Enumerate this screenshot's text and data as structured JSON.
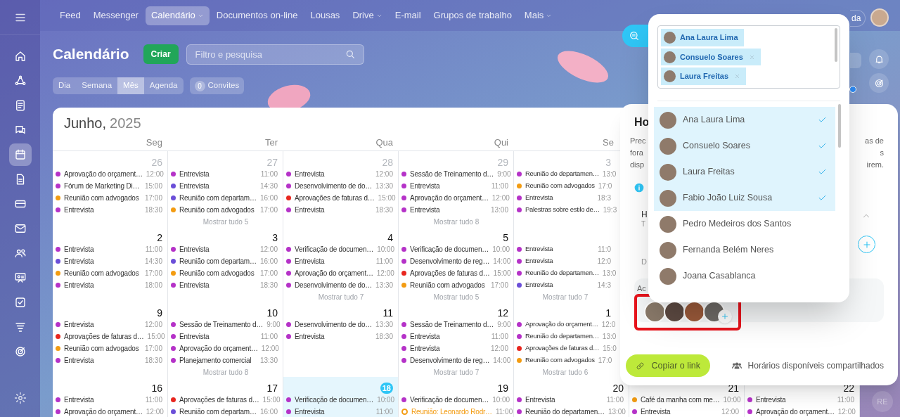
{
  "sidebar": {
    "items": [
      {
        "kind": "home",
        "selected": false
      },
      {
        "kind": "network",
        "selected": false
      },
      {
        "kind": "document",
        "selected": false
      },
      {
        "kind": "chat",
        "selected": false
      },
      {
        "kind": "calendar",
        "selected": true
      },
      {
        "kind": "file",
        "selected": false
      },
      {
        "kind": "card",
        "selected": false
      },
      {
        "kind": "mail",
        "selected": false
      },
      {
        "kind": "contacts",
        "selected": false
      },
      {
        "kind": "board",
        "selected": false
      },
      {
        "kind": "tasks",
        "selected": false
      },
      {
        "kind": "filter",
        "selected": false
      },
      {
        "kind": "target",
        "selected": false
      }
    ]
  },
  "nav": {
    "items": [
      {
        "label": "Feed",
        "selected": false,
        "dropdown": false
      },
      {
        "label": "Messenger",
        "selected": false,
        "dropdown": false
      },
      {
        "label": "Calendário",
        "selected": true,
        "dropdown": true
      },
      {
        "label": "Documentos on-line",
        "selected": false,
        "dropdown": false
      },
      {
        "label": "Lousas",
        "selected": false,
        "dropdown": false
      },
      {
        "label": "Drive",
        "selected": false,
        "dropdown": true
      },
      {
        "label": "E-mail",
        "selected": false,
        "dropdown": false
      },
      {
        "label": "Grupos de trabalho",
        "selected": false,
        "dropdown": false
      },
      {
        "label": "Mais",
        "selected": false,
        "dropdown": true
      }
    ],
    "help_fragment": "da"
  },
  "header": {
    "title": "Calendário",
    "create_button": "Criar",
    "search": {
      "placeholder": "Filtro e pesquisa"
    }
  },
  "views": [
    {
      "label": "Dia",
      "selected": false
    },
    {
      "label": "Semana",
      "selected": false
    },
    {
      "label": "Mês",
      "selected": true
    },
    {
      "label": "Agenda",
      "selected": false
    }
  ],
  "invites": {
    "count": "0",
    "label": "Convites"
  },
  "calendar": {
    "month": "Junho,",
    "year": "2025",
    "weekdays": [
      "Seg",
      "Ter",
      "Qua",
      "Qui",
      "Se"
    ],
    "weeks": [
      {
        "days": [
          {
            "date": "26",
            "muted": true,
            "today": false,
            "events": [
              {
                "title": "Aprovação do orçament…",
                "time": "12:00",
                "color": "#b532c8",
                "kind": "event"
              },
              {
                "title": "Fórum de Marketing Di…",
                "time": "15:00",
                "color": "#b532c8",
                "kind": "event"
              },
              {
                "title": "Reunião com advogados",
                "time": "17:00",
                "color": "#f39c12",
                "kind": "event"
              },
              {
                "title": "Entrevista",
                "time": "18:30",
                "color": "#b532c8",
                "kind": "event"
              }
            ]
          },
          {
            "date": "27",
            "muted": true,
            "today": false,
            "more": "Mostrar tudo 5",
            "events": [
              {
                "title": "Entrevista",
                "time": "11:00",
                "color": "#b532c8",
                "kind": "event"
              },
              {
                "title": "Entrevista",
                "time": "14:30",
                "color": "#6b4fd8",
                "kind": "event"
              },
              {
                "title": "Reunião com departam…",
                "time": "16:00",
                "color": "#6b4fd8",
                "kind": "event"
              },
              {
                "title": "Reunião com advogados",
                "time": "17:00",
                "color": "#f39c12",
                "kind": "event"
              }
            ]
          },
          {
            "date": "28",
            "muted": true,
            "today": false,
            "events": [
              {
                "title": "Entrevista",
                "time": "12:00",
                "color": "#b532c8",
                "kind": "event"
              },
              {
                "title": "Desenvolvimento de do…",
                "time": "13:30",
                "color": "#b532c8",
                "kind": "event"
              },
              {
                "title": "Aprovações de faturas d…",
                "time": "15:00",
                "color": "#e8261f",
                "kind": "event"
              },
              {
                "title": "Entrevista",
                "time": "18:30",
                "color": "#b532c8",
                "kind": "event"
              }
            ]
          },
          {
            "date": "29",
            "muted": true,
            "today": false,
            "more": "Mostrar tudo 8",
            "events": [
              {
                "title": "Sessão de Treinamento d…",
                "time": "9:00",
                "color": "#b532c8",
                "kind": "event"
              },
              {
                "title": "Entrevista",
                "time": "11:00",
                "color": "#b532c8",
                "kind": "event"
              },
              {
                "title": "Aprovação do orçament…",
                "time": "12:00",
                "color": "#b532c8",
                "kind": "event"
              },
              {
                "title": "Entrevista",
                "time": "13:00",
                "color": "#b532c8",
                "kind": "event"
              }
            ]
          },
          {
            "date": "3",
            "muted": true,
            "today": false,
            "events": [
              {
                "title": "Reunião do departamen…",
                "time": "13:0",
                "color": "#b532c8",
                "kind": "event"
              },
              {
                "title": "Reunião com advogados",
                "time": "17:0",
                "color": "#f39c12",
                "kind": "event"
              },
              {
                "title": "Entrevista",
                "time": "18:3",
                "color": "#b532c8",
                "kind": "event"
              },
              {
                "title": "Palestras sobre estilo de…",
                "time": "19:3",
                "color": "#b532c8",
                "kind": "event"
              }
            ]
          }
        ]
      },
      {
        "days": [
          {
            "date": "2",
            "muted": false,
            "today": false,
            "events": [
              {
                "title": "Entrevista",
                "time": "11:00",
                "color": "#b532c8",
                "kind": "event"
              },
              {
                "title": "Entrevista",
                "time": "14:30",
                "color": "#6b4fd8",
                "kind": "event"
              },
              {
                "title": "Reunião com advogados",
                "time": "17:00",
                "color": "#f39c12",
                "kind": "event"
              },
              {
                "title": "Entrevista",
                "time": "18:00",
                "color": "#b532c8",
                "kind": "event"
              }
            ]
          },
          {
            "date": "3",
            "muted": false,
            "today": false,
            "events": [
              {
                "title": "Entrevista",
                "time": "12:00",
                "color": "#b532c8",
                "kind": "event"
              },
              {
                "title": "Reunião com departam…",
                "time": "16:00",
                "color": "#6b4fd8",
                "kind": "event"
              },
              {
                "title": "Reunião com advogados",
                "time": "17:00",
                "color": "#f39c12",
                "kind": "event"
              },
              {
                "title": "Entrevista",
                "time": "18:30",
                "color": "#b532c8",
                "kind": "event"
              }
            ]
          },
          {
            "date": "4",
            "muted": false,
            "today": false,
            "more": "Mostrar tudo 7",
            "events": [
              {
                "title": "Verificação de documen…",
                "time": "10:00",
                "color": "#b532c8",
                "kind": "event"
              },
              {
                "title": "Entrevista",
                "time": "11:00",
                "color": "#b532c8",
                "kind": "event"
              },
              {
                "title": "Aprovação do orçament…",
                "time": "12:00",
                "color": "#b532c8",
                "kind": "event"
              },
              {
                "title": "Desenvolvimento de do…",
                "time": "13:30",
                "color": "#b532c8",
                "kind": "event"
              }
            ]
          },
          {
            "date": "5",
            "muted": false,
            "today": false,
            "more": "Mostrar tudo 5",
            "events": [
              {
                "title": "Verificação de documen…",
                "time": "10:00",
                "color": "#b532c8",
                "kind": "event"
              },
              {
                "title": "Desenvolvimento de reg…",
                "time": "14:00",
                "color": "#b532c8",
                "kind": "event"
              },
              {
                "title": "Aprovações de faturas d…",
                "time": "15:00",
                "color": "#e8261f",
                "kind": "event"
              },
              {
                "title": "Reunião com advogados",
                "time": "17:00",
                "color": "#f39c12",
                "kind": "event"
              }
            ]
          },
          {
            "today": false,
            "more": "Mostrar tudo 7",
            "events": [
              {
                "title": "Entrevista",
                "time": "11:0",
                "color": "#b532c8",
                "kind": "event"
              },
              {
                "title": "Entrevista",
                "time": "12:0",
                "color": "#b532c8",
                "kind": "event"
              },
              {
                "title": "Reunião do departamen…",
                "time": "13:0",
                "color": "#b532c8",
                "kind": "event"
              },
              {
                "title": "Entrevista",
                "time": "14:3",
                "color": "#6b4fd8",
                "kind": "event"
              }
            ]
          }
        ]
      },
      {
        "days": [
          {
            "date": "9",
            "muted": false,
            "today": false,
            "events": [
              {
                "title": "Entrevista",
                "time": "12:00",
                "color": "#b532c8",
                "kind": "event"
              },
              {
                "title": "Aprovações de faturas d…",
                "time": "15:00",
                "color": "#e8261f",
                "kind": "event"
              },
              {
                "title": "Reunião com advogados",
                "time": "17:00",
                "color": "#f39c12",
                "kind": "event"
              },
              {
                "title": "Entrevista",
                "time": "18:30",
                "color": "#b532c8",
                "kind": "event"
              }
            ]
          },
          {
            "date": "10",
            "muted": false,
            "today": false,
            "more": "Mostrar tudo 8",
            "events": [
              {
                "title": "Sessão de Treinamento d…",
                "time": "9:00",
                "color": "#b532c8",
                "kind": "event"
              },
              {
                "title": "Entrevista",
                "time": "11:00",
                "color": "#b532c8",
                "kind": "event"
              },
              {
                "title": "Aprovação do orçament…",
                "time": "12:00",
                "color": "#b532c8",
                "kind": "event"
              },
              {
                "title": "Planejamento comercial",
                "time": "13:30",
                "color": "#b532c8",
                "kind": "event"
              }
            ]
          },
          {
            "date": "11",
            "muted": false,
            "today": false,
            "events": [
              {
                "title": "Desenvolvimento de do…",
                "time": "13:30",
                "color": "#b532c8",
                "kind": "event"
              },
              {
                "title": "Entrevista",
                "time": "18:30",
                "color": "#b532c8",
                "kind": "event"
              }
            ]
          },
          {
            "date": "12",
            "muted": false,
            "today": false,
            "more": "Mostrar tudo 7",
            "events": [
              {
                "title": "Sessão de Treinamento d…",
                "time": "9:00",
                "color": "#b532c8",
                "kind": "event"
              },
              {
                "title": "Entrevista",
                "time": "11:00",
                "color": "#b532c8",
                "kind": "event"
              },
              {
                "title": "Entrevista",
                "time": "12:00",
                "color": "#b532c8",
                "kind": "event"
              },
              {
                "title": "Desenvolvimento de reg…",
                "time": "14:00",
                "color": "#b532c8",
                "kind": "event"
              }
            ]
          },
          {
            "date": "1",
            "muted": false,
            "today": false,
            "more": "Mostrar tudo 6",
            "events": [
              {
                "title": "Aprovação do orçament…",
                "time": "12:0",
                "color": "#b532c8",
                "kind": "event"
              },
              {
                "title": "Reunião do departamen…",
                "time": "13:0",
                "color": "#b532c8",
                "kind": "event"
              },
              {
                "title": "Aprovações de faturas d…",
                "time": "15:0",
                "color": "#e8261f",
                "kind": "event"
              },
              {
                "title": "Reunião com advogados",
                "time": "17:0",
                "color": "#f39c12",
                "kind": "event"
              }
            ]
          }
        ]
      },
      {
        "days": [
          {
            "date": "16",
            "muted": false,
            "today": false,
            "events": [
              {
                "title": "Entrevista",
                "time": "11:00",
                "color": "#b532c8",
                "kind": "event"
              },
              {
                "title": "Aprovação do orçament…",
                "time": "12:00",
                "color": "#b532c8",
                "kind": "event"
              }
            ]
          },
          {
            "date": "17",
            "muted": false,
            "today": false,
            "events": [
              {
                "title": "Aprovações de faturas d…",
                "time": "15:00",
                "color": "#e8261f",
                "kind": "event"
              },
              {
                "title": "Reunião com departam…",
                "time": "16:00",
                "color": "#6b4fd8",
                "kind": "event"
              }
            ]
          },
          {
            "date": "18",
            "muted": false,
            "today": true,
            "events": [
              {
                "title": "Verificação de documen…",
                "time": "10:00",
                "color": "#b532c8",
                "kind": "event"
              },
              {
                "title": "Entrevista",
                "time": "11:00",
                "color": "#b532c8",
                "kind": "event"
              }
            ]
          },
          {
            "date": "19",
            "muted": false,
            "today": false,
            "events": [
              {
                "title": "Verificação de documen…",
                "time": "10:00",
                "color": "#b532c8",
                "kind": "event"
              },
              {
                "title": "Reunião: Leonardo Rodr…",
                "time": "11:00",
                "color": "#f39c12",
                "kind": "invite"
              }
            ]
          },
          {
            "date": "20",
            "muted": false,
            "today": false,
            "events": [
              {
                "title": "Entrevista",
                "time": "11:00",
                "color": "#b532c8",
                "kind": "event"
              },
              {
                "title": "Reunião do departamen…",
                "time": "13:00",
                "color": "#b532c8",
                "kind": "event"
              }
            ]
          },
          {
            "date": "21",
            "muted": false,
            "today": false,
            "events": [
              {
                "title": "Café da manha com me…",
                "time": "10:00",
                "color": "#f39c12",
                "kind": "event"
              },
              {
                "title": "Entrevista",
                "time": "12:00",
                "color": "#b532c8",
                "kind": "event"
              }
            ]
          },
          {
            "date": "22",
            "muted": false,
            "today": false,
            "events": [
              {
                "title": "Entrevista",
                "time": "11:00",
                "color": "#b532c8",
                "kind": "event"
              },
              {
                "title": "Aprovação do orçament…",
                "time": "12:00",
                "color": "#b532c8",
                "kind": "event"
              }
            ]
          }
        ]
      }
    ]
  },
  "panel": {
    "title": "Ho",
    "description_left": [
      "Prec",
      "fora",
      "disp"
    ],
    "description_right": [
      "as de",
      "s",
      "irem."
    ],
    "section_label": "H",
    "section_hint": "T",
    "field_label": "D",
    "attendees_label": "Ac",
    "copy_button": "Copiar o link",
    "shared_link": "Horários disponíveis compartilhados"
  },
  "people_picker": {
    "chips": [
      {
        "name": "Ana Laura Lima",
        "removable": false
      },
      {
        "name": "Consuelo Soares",
        "removable": true
      },
      {
        "name": "Laura Freitas",
        "removable": true
      }
    ],
    "people": [
      {
        "name": "Ana Laura Lima",
        "selected": true
      },
      {
        "name": "Consuelo Soares",
        "selected": true
      },
      {
        "name": "Laura Freitas",
        "selected": true
      },
      {
        "name": "Fabio João Luiz Sousa",
        "selected": true
      },
      {
        "name": "Pedro Medeiros dos Santos",
        "selected": false
      },
      {
        "name": "Fernanda Belém Neres",
        "selected": false
      },
      {
        "name": "Joana Casablanca",
        "selected": false
      }
    ]
  },
  "user_badge": "RE"
}
